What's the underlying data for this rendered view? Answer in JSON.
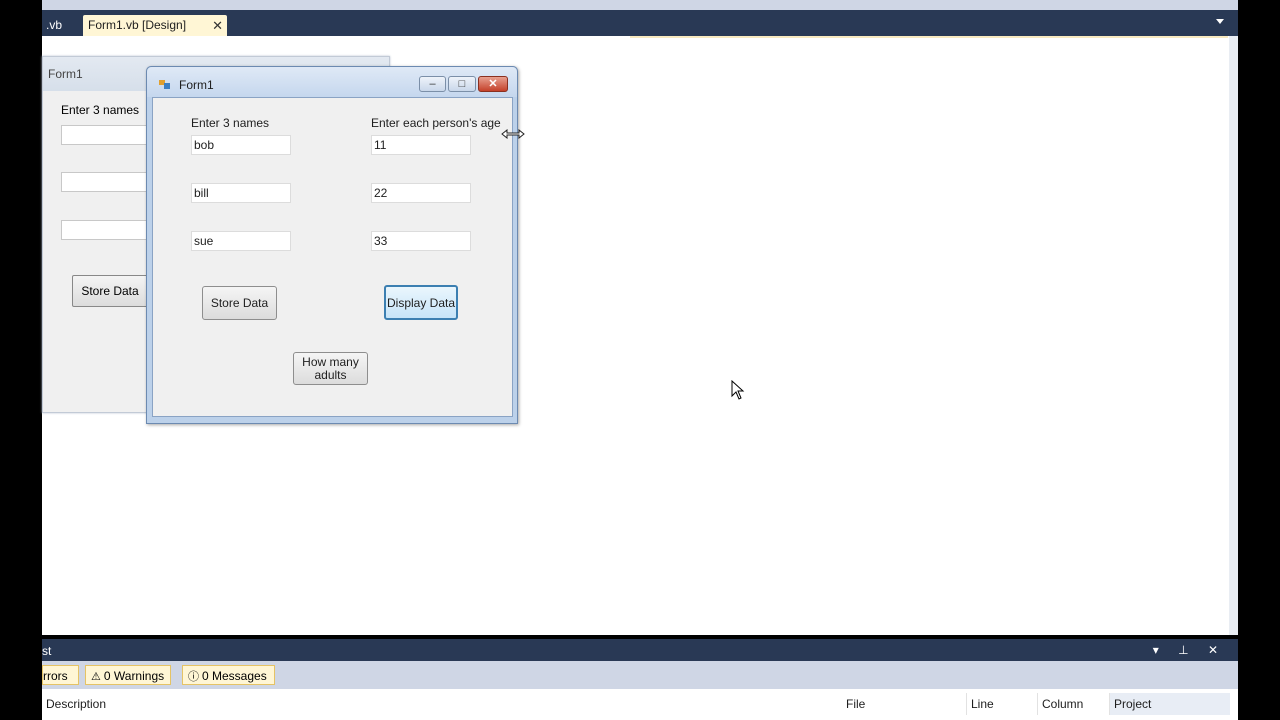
{
  "tabs": {
    "vb_tab": ".vb",
    "design_tab": "Form1.vb [Design]",
    "close_glyph": "✕"
  },
  "design_form": {
    "title": "Form1",
    "label": "Enter 3 names",
    "button_label": "Store Data"
  },
  "run_form": {
    "title": "Form1",
    "names_label": "Enter 3 names",
    "ages_label": "Enter each person's age",
    "names": [
      "bob",
      "bill",
      "sue"
    ],
    "ages": [
      "11",
      "22",
      "33"
    ],
    "store_button": "Store Data",
    "display_button": "Display Data",
    "adults_button_line1": "How many",
    "adults_button_line2": "adults",
    "caption": {
      "minimize": "–",
      "maximize": "□",
      "close": "✕"
    }
  },
  "error_list": {
    "title": "st",
    "errors_label": "rrors",
    "warnings_label": "0 Warnings",
    "messages_label": "0 Messages",
    "columns": [
      "Description",
      "File",
      "Line",
      "Column",
      "Project"
    ],
    "controls": "▾ ⊥ ✕"
  },
  "colors": {
    "tab_strip": "#293955",
    "active_tab": "#fff6d5",
    "window_frame": "#bcd1ea",
    "selected_button_border": "#3c7fb1"
  }
}
